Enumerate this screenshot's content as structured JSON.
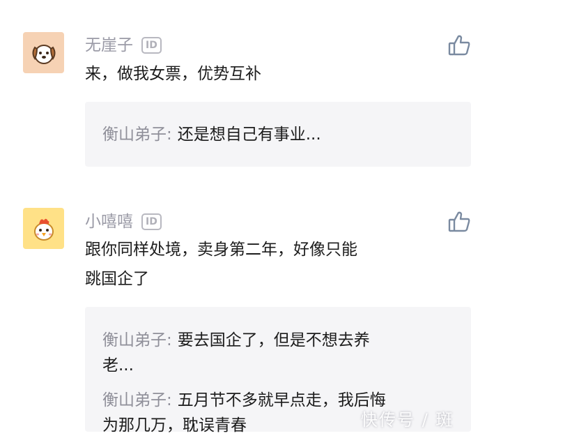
{
  "comments": [
    {
      "username": "无崖子",
      "id_badge": "ID",
      "avatar_icon": "dog-avatar-icon",
      "text_lines": [
        "来，做我女票，优势互补"
      ],
      "replies": [
        {
          "author": "衡山弟子",
          "colon": ":",
          "lines": [
            "还是想自己有事业..."
          ]
        }
      ]
    },
    {
      "username": "小嘻嘻",
      "id_badge": "ID",
      "avatar_icon": "chicken-avatar-icon",
      "text_lines": [
        "跟你同样处境，卖身第二年，好像只能",
        "跳国企了"
      ],
      "replies": [
        {
          "author": "衡山弟子",
          "colon": ":",
          "lines": [
            "要去国企了，但是不想去养",
            "老..."
          ]
        },
        {
          "author": "衡山弟子",
          "colon": ":",
          "lines": [
            "五月节不多就早点走，我后悔",
            "为那几万，耽误青春"
          ]
        }
      ]
    }
  ],
  "watermark": "快传号 / 斑",
  "colors": {
    "username": "#9a9aa6",
    "reply_bg": "#f5f5f7",
    "like_icon": "#7a8aa0",
    "dog_avatar_bg": "#f6d2b4",
    "chicken_avatar_bg": "#ffe187"
  }
}
